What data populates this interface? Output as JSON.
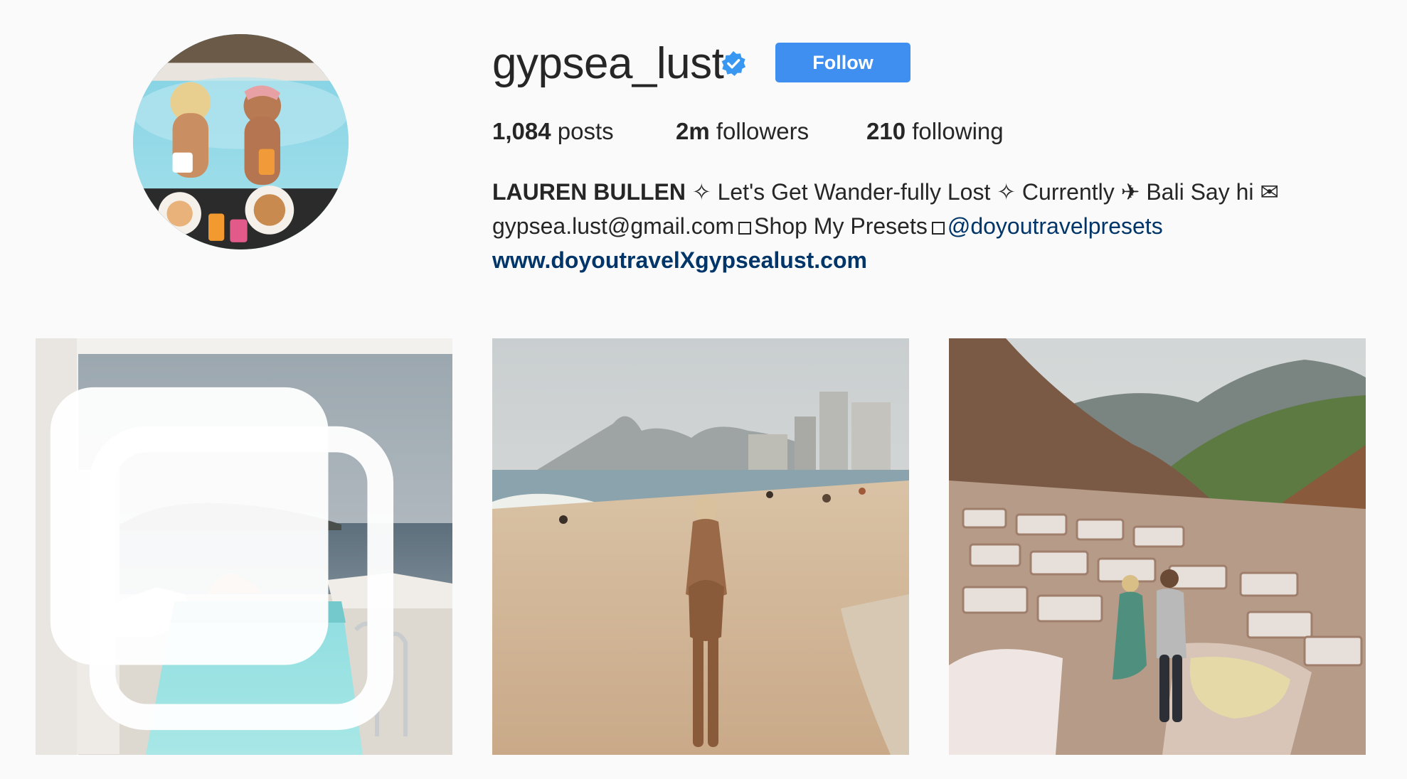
{
  "profile": {
    "username": "gypsea_lust",
    "verified": true,
    "follow_label": "Follow",
    "accent_color": "#3f8ff0"
  },
  "stats": {
    "posts_count": "1,084",
    "posts_label": "posts",
    "followers_count": "2m",
    "followers_label": "followers",
    "following_count": "210",
    "following_label": "following"
  },
  "bio": {
    "name": "LAUREN BULLEN",
    "line1_rest": "✧ Let's Get Wander-fully Lost ✧ Currently ✈ Bali Say hi ✉",
    "email": "gypsea.lust@gmail.com",
    "shop": "Shop My Presets",
    "mention": "@doyoutravelpresets",
    "website": "www.doyoutravelXgypsealust.com"
  },
  "posts": [
    {
      "type": "carousel",
      "icon": "multiple-photos-icon"
    },
    {
      "type": "photo"
    },
    {
      "type": "photo"
    }
  ]
}
